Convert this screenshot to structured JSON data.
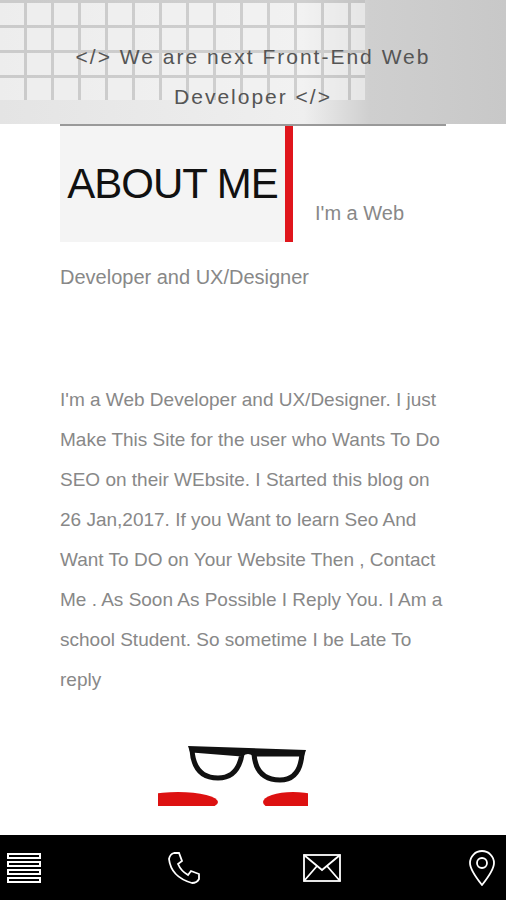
{
  "hero": {
    "text": "</> We are next Front-End Web Developer </>"
  },
  "about": {
    "title": "ABOUT ME",
    "subtitle": "I'm a Web Developer and UX/Designer",
    "body": "I'm a Web Developer and UX/Designer. I just Make This Site for the user who Wants To Do SEO on their WEbsite. I Started this blog on 26 Jan,2017. If you Want to learn Seo And Want To DO on Your Website Then , Contact Me . As Soon As Possible I Reply You. I Am a school Student. So sometime I be Late To reply"
  }
}
